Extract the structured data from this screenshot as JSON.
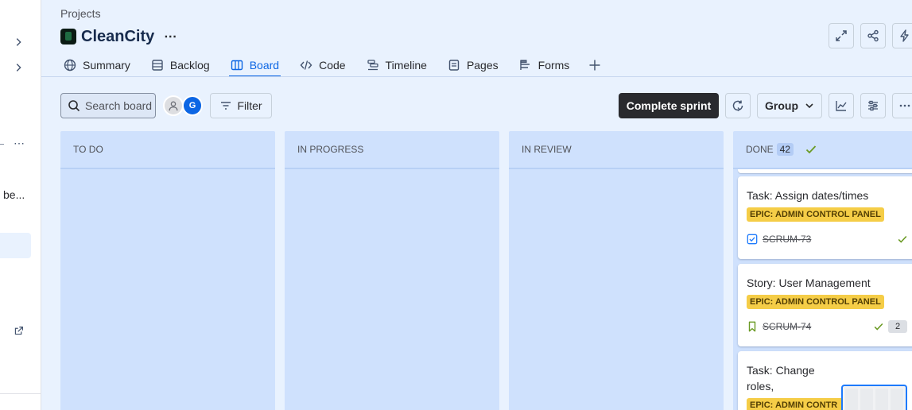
{
  "breadcrumb": "Projects",
  "project": {
    "name": "CleanCity",
    "more": "⋯"
  },
  "sidebar": {
    "truncated_label": "be...",
    "dots": "⋯"
  },
  "tabs": [
    {
      "label": "Summary",
      "icon": "globe-icon"
    },
    {
      "label": "Backlog",
      "icon": "backlog-icon"
    },
    {
      "label": "Board",
      "icon": "board-icon",
      "active": true
    },
    {
      "label": "Code",
      "icon": "code-icon"
    },
    {
      "label": "Timeline",
      "icon": "timeline-icon"
    },
    {
      "label": "Pages",
      "icon": "pages-icon"
    },
    {
      "label": "Forms",
      "icon": "forms-icon"
    }
  ],
  "toolbar": {
    "search_placeholder": "Search board",
    "avatar_initial": "G",
    "filter_label": "Filter",
    "complete_sprint_label": "Complete sprint",
    "group_label": "Group"
  },
  "columns": [
    {
      "title": "TO DO"
    },
    {
      "title": "IN PROGRESS"
    },
    {
      "title": "IN REVIEW"
    },
    {
      "title": "DONE",
      "count": "42"
    }
  ],
  "cards": [
    {
      "title": "Task: Assign dates/times",
      "epic": "EPIC: ADMIN CONTROL PANEL",
      "key": "SCRUM-73",
      "type": "task-icon"
    },
    {
      "title": "Story: User Management",
      "epic": "EPIC: ADMIN CONTROL PANEL",
      "key": "SCRUM-74",
      "type": "story-icon",
      "points": "2"
    },
    {
      "title": "Task: Change roles, suspend/delete use",
      "epic": "EPIC: ADMIN CONTR"
    }
  ],
  "colors": {
    "accent": "#0C66E4",
    "epic": "#F5CD47",
    "column": "#CFE1FD",
    "background": "#E9F2FE"
  }
}
